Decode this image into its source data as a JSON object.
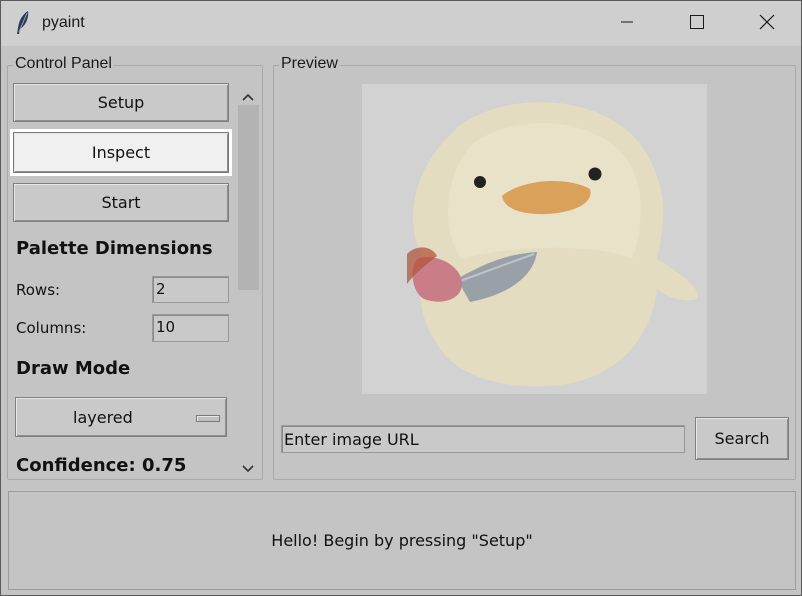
{
  "window": {
    "title": "pyaint",
    "controls": {
      "minimize_icon": "minimize-icon",
      "maximize_icon": "maximize-icon",
      "close_icon": "close-icon"
    }
  },
  "control_panel": {
    "label": "Control Panel",
    "buttons": {
      "setup": "Setup",
      "inspect": "Inspect",
      "start": "Start"
    },
    "palette_dimensions": {
      "title": "Palette Dimensions",
      "rows_label": "Rows:",
      "rows_value": "2",
      "columns_label": "Columns:",
      "columns_value": "10"
    },
    "draw_mode": {
      "title": "Draw Mode",
      "selected": "layered"
    },
    "confidence": "Confidence: 0.75"
  },
  "preview": {
    "label": "Preview",
    "image_description": "chick-with-knife-image",
    "url_input": {
      "value": "Enter image URL"
    },
    "search_label": "Search"
  },
  "status": {
    "message": "Hello! Begin by pressing \"Setup\""
  },
  "colors": {
    "background": "#c4c4c4",
    "focused_button": "#f0f0f0"
  }
}
